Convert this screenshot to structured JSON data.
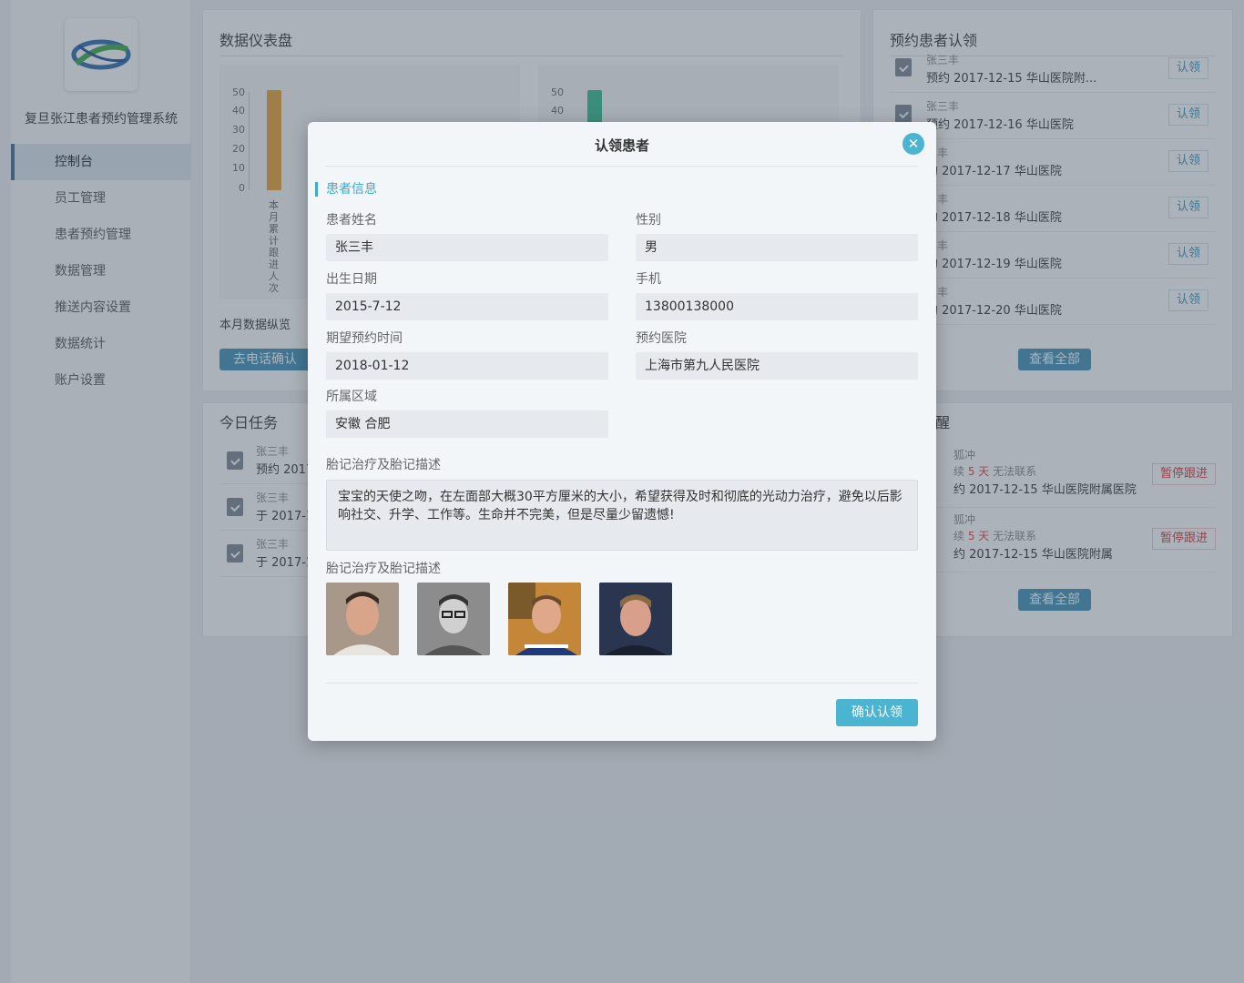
{
  "app": {
    "system_title": "复旦张江患者预约管理系统"
  },
  "sidebar": {
    "items": [
      {
        "label": "控制台"
      },
      {
        "label": "员工管理"
      },
      {
        "label": "患者预约管理"
      },
      {
        "label": "数据管理"
      },
      {
        "label": "推送内容设置"
      },
      {
        "label": "数据统计"
      },
      {
        "label": "账户设置"
      }
    ]
  },
  "dashboard": {
    "title": "数据仪表盘",
    "chart_caption": "本月数据纵览",
    "phone_confirm_label": "去电话确认"
  },
  "chart_data": [
    {
      "type": "bar",
      "categories": [
        "本月累计跟进人次"
      ],
      "values": [
        51
      ],
      "ylim": [
        0,
        50
      ],
      "yticks": [
        "0",
        "10",
        "20",
        "30",
        "40",
        "50"
      ],
      "color": "#e8a030"
    },
    {
      "type": "bar",
      "categories": [
        ""
      ],
      "values": [
        51
      ],
      "ylim": [
        0,
        50
      ],
      "yticks": [
        "40",
        "50"
      ],
      "color": "#2ec08c"
    }
  ],
  "claims": {
    "title": "预约患者认领",
    "claim_label": "认领",
    "view_all_label": "查看全部",
    "rows": [
      {
        "name": "张三丰",
        "desc": "预约 2017-12-15 华山医院附..."
      },
      {
        "name": "张三丰",
        "desc": "预约 2017-12-16 华山医院"
      },
      {
        "name": "三丰",
        "desc": "约 2017-12-17 华山医院"
      },
      {
        "name": "三丰",
        "desc": "约 2017-12-18 华山医院"
      },
      {
        "name": "三丰",
        "desc": "约 2017-12-19 华山医院"
      },
      {
        "name": "三丰",
        "desc": "约 2017-12-20 华山医院"
      }
    ]
  },
  "tasks": {
    "title": "今日任务",
    "rows": [
      {
        "name": "张三丰",
        "desc": "预约 2017"
      },
      {
        "name": "张三丰",
        "desc": "于 2017-1"
      },
      {
        "name": "张三丰",
        "desc": "于 2017-1"
      }
    ]
  },
  "reminders": {
    "title": "醒",
    "pause_label": "暂停跟进",
    "view_all_label": "查看全部",
    "rows": [
      {
        "name": "狐冲",
        "prefix": "续",
        "days": "5 天",
        "suffix": "无法联系",
        "desc": "约 2017-12-15 华山医院附属医院"
      },
      {
        "name": "狐冲",
        "prefix": "续",
        "days": "5 天",
        "suffix": "无法联系",
        "desc": "约 2017-12-15 华山医院附属"
      }
    ]
  },
  "modal": {
    "title": "认领患者",
    "section_title": "患者信息",
    "fields": {
      "name_label": "患者姓名",
      "name_value": "张三丰",
      "gender_label": "性别",
      "gender_value": "男",
      "birth_label": "出生日期",
      "birth_value": "2015-7-12",
      "phone_label": "手机",
      "phone_value": "13800138000",
      "expect_label": "期望预约时间",
      "expect_value": "2018-01-12",
      "hospital_label": "预约医院",
      "hospital_value": "上海市第九人民医院",
      "region_label": "所属区域",
      "region_value": "安徽  合肥"
    },
    "desc_label": "胎记治疗及胎记描述",
    "desc_value": "宝宝的天使之吻，在左面部大概30平方厘米的大小，希望获得及时和彻底的光动力治疗，避免以后影响社交、升学、工作等。生命并不完美，但是尽量少留遗憾!",
    "photos_label": "胎记治疗及胎记描述",
    "confirm_label": "确认认领",
    "close_icon": "close-icon"
  }
}
